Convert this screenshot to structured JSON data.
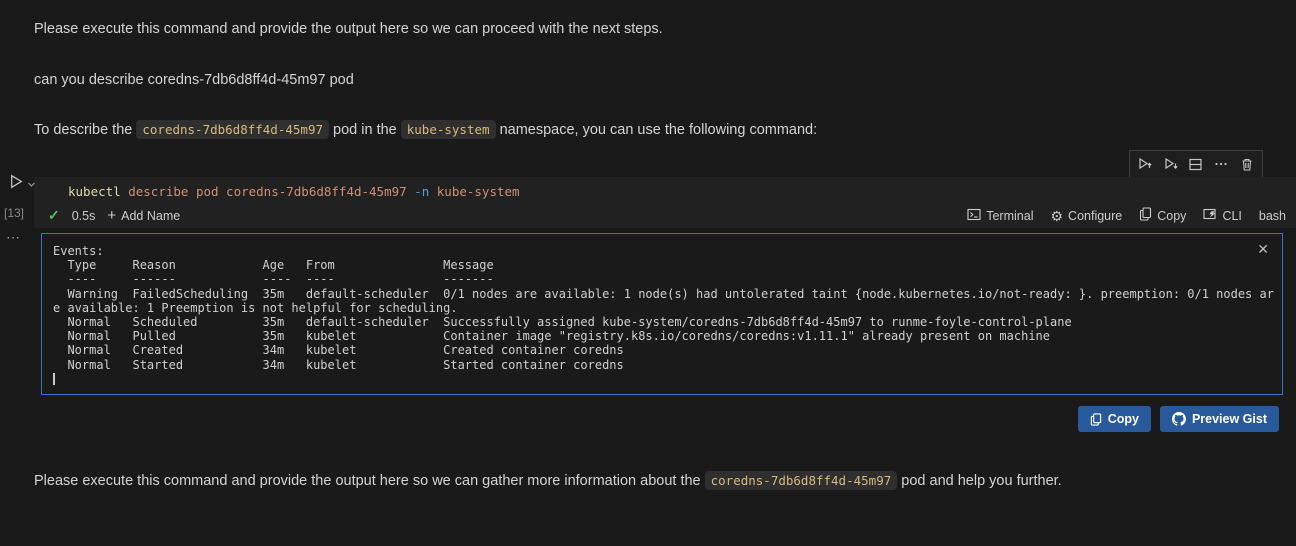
{
  "conversation": {
    "top_message": "Please execute this command and provide the output here so we can proceed with the next steps.",
    "user_question": "can you describe coredns-7db6d8ff4d-45m97 pod",
    "intro": {
      "prefix": "To describe the ",
      "pod_code": "coredns-7db6d8ff4d-45m97",
      "middle": " pod in the ",
      "namespace_code": "kube-system",
      "suffix": " namespace, you can use the following command:"
    },
    "footer": {
      "prefix": "Please execute this command and provide the output here so we can gather more information about the ",
      "pod_code": "coredns-7db6d8ff4d-45m97",
      "suffix": " pod and help you further."
    }
  },
  "cell": {
    "execution_count": "[13]",
    "code": {
      "tokens": [
        {
          "text": "kubectl",
          "color": "#dcdcaa"
        },
        {
          "text": " describe pod coredns-7db6d8ff4d-45m97 ",
          "color": "#ce9178"
        },
        {
          "text": "-n",
          "color": "#569cd6"
        },
        {
          "text": " kube-system",
          "color": "#ce9178"
        }
      ]
    },
    "toolbar_icons": [
      "execute-above",
      "execute-below",
      "split-cell",
      "more-actions",
      "delete-cell"
    ],
    "status_bar": {
      "duration": "0.5s",
      "add_name_label": "Add Name",
      "terminal_label": "Terminal",
      "configure_label": "Configure",
      "copy_label": "Copy",
      "cli_label": "CLI",
      "language": "bash"
    }
  },
  "output": {
    "terminal_lines": [
      "Events:",
      "  Type     Reason            Age   From               Message",
      "  ----     ------            ----  ----               -------",
      "  Warning  FailedScheduling  35m   default-scheduler  0/1 nodes are available: 1 node(s) had untolerated taint {node.kubernetes.io/not-ready: }. preemption: 0/1 nodes ar",
      "e available: 1 Preemption is not helpful for scheduling.",
      "  Normal   Scheduled         35m   default-scheduler  Successfully assigned kube-system/coredns-7db6d8ff4d-45m97 to runme-foyle-control-plane",
      "  Normal   Pulled            35m   kubelet            Container image \"registry.k8s.io/coredns/coredns:v1.11.1\" already present on machine",
      "  Normal   Created           34m   kubelet            Created container coredns",
      "  Normal   Started           34m   kubelet            Started container coredns"
    ],
    "buttons": {
      "copy": "Copy",
      "preview_gist": "Preview Gist"
    }
  },
  "icons": {
    "run_cell": "play-outline",
    "run_dropdown": "chevron-down",
    "success_check": "✓",
    "plus": "+",
    "gear": "⚙",
    "output_menu_ellipsis": "⋯",
    "close_output": "✕"
  },
  "colors": {
    "accent_button": "#27599b",
    "terminal_border": "#3274c9",
    "inline_code_text": "#d7ba7d",
    "success_green": "#4ec36a"
  }
}
